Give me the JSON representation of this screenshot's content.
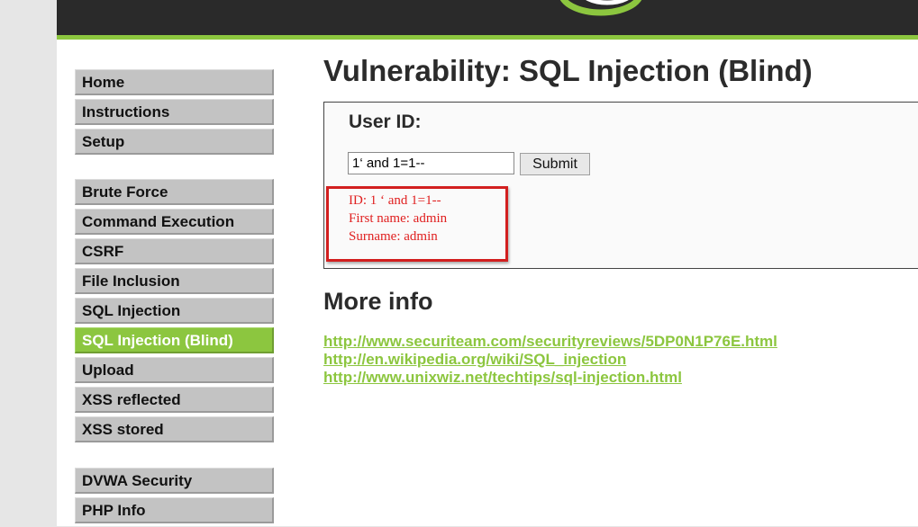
{
  "header": {
    "logo_icon": "dvwa-swirl-logo"
  },
  "colors": {
    "accent": "#8cc63f",
    "header_bg": "#2a2a2a",
    "menu_bg": "#c3c3c3",
    "result_text": "#e02020",
    "highlight_border": "#d21f1f"
  },
  "menu": {
    "group1": [
      {
        "label": "Home"
      },
      {
        "label": "Instructions"
      },
      {
        "label": "Setup"
      }
    ],
    "group2": [
      {
        "label": "Brute Force"
      },
      {
        "label": "Command Execution"
      },
      {
        "label": "CSRF"
      },
      {
        "label": "File Inclusion"
      },
      {
        "label": "SQL Injection"
      },
      {
        "label": "SQL Injection (Blind)",
        "selected": true
      },
      {
        "label": "Upload"
      },
      {
        "label": "XSS reflected"
      },
      {
        "label": "XSS stored"
      }
    ],
    "group3": [
      {
        "label": "DVWA Security"
      },
      {
        "label": "PHP Info"
      }
    ]
  },
  "main": {
    "title": "Vulnerability: SQL Injection (Blind)",
    "form": {
      "label": "User ID:",
      "input_value": "1‘ and 1=1--",
      "submit_label": "Submit"
    },
    "result": {
      "id_line": "ID: 1 ‘ and 1=1--",
      "first_name_line": "First name: admin",
      "surname_line": "Surname: admin"
    },
    "more_info": {
      "heading": "More info",
      "links": [
        "http://www.securiteam.com/securityreviews/5DP0N1P76E.html",
        "http://en.wikipedia.org/wiki/SQL_injection",
        "http://www.unixwiz.net/techtips/sql-injection.html"
      ]
    }
  }
}
